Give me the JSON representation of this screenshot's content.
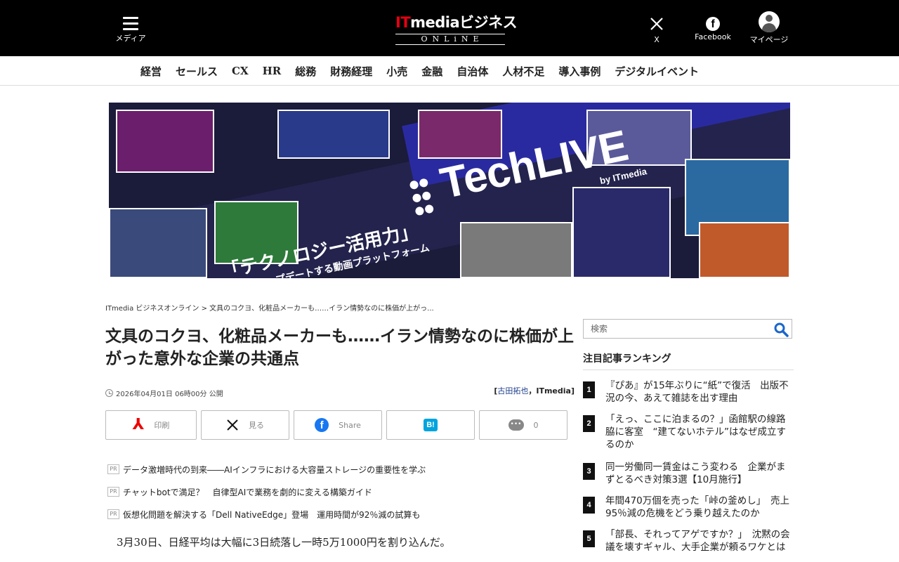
{
  "header": {
    "menu_label": "メディア",
    "logo_main_it": "IT",
    "logo_main_rest": "mediaビジネス",
    "logo_sub": "ONLiNE",
    "x_label": "X",
    "facebook_label": "Facebook",
    "mypage_label": "マイページ"
  },
  "categories": [
    "経営",
    "セールス",
    "CX",
    "HR",
    "総務",
    "財務経理",
    "小売",
    "金融",
    "自治体",
    "人材不足",
    "導入事例",
    "デジタルイベント"
  ],
  "banner": {
    "brand": "TechLIVE",
    "by": "by ITmedia",
    "tagline_1": "「テクノロジー活用力」",
    "tagline_2": "をアップデートする動画プラットフォーム"
  },
  "breadcrumb": {
    "home": "ITmedia ビジネスオンライン",
    "separator": " > ",
    "current": "文具のコクヨ、化粧品メーカーも……イラン情勢なのに株価が上がっ..."
  },
  "article": {
    "title": "文具のコクヨ、化粧品メーカーも……イラン情勢なのに株価が上がった意外な企業の共通点",
    "published": "2026年04月01日 06時00分 公開",
    "author_open": "[",
    "author_name": "古田拓也",
    "author_sep": "，",
    "author_org": "ITmedia",
    "author_close": "]",
    "lead": "3月30日、日経平均は大幅に3日続落し一時5万1000円を割り込んだ。"
  },
  "share": {
    "print_label": "印刷",
    "x_label": "見る",
    "facebook_label": "Share",
    "hatena_label": "B!",
    "comment_count": "0"
  },
  "pr": {
    "badge": "PR",
    "items": [
      "データ激増時代の到来――AIインフラにおける大容量ストレージの重要性を学ぶ",
      "チャットbotで満足？　自律型AIで業務を劇的に変える構築ガイド",
      "仮想化問題を解決する「Dell NativeEdge」登場　運用時間が92％減の試算も"
    ]
  },
  "sidebar": {
    "search_placeholder": "検索",
    "ranking_title": "注目記事ランキング",
    "ranking": [
      {
        "num": "1",
        "text": "『ぴあ』が15年ぶりに“紙”で復活　出版不況の今、あえて雑誌を出す理由"
      },
      {
        "num": "2",
        "text": "「えっ、ここに泊まるの？」函館駅の線路脇に客室　“建てないホテル”はなぜ成立するのか"
      },
      {
        "num": "3",
        "text": "同一労働同一賃金はこう変わる　企業がまずとるべき対策3選【10月施行】"
      },
      {
        "num": "4",
        "text": "年間470万個を売った「峠の釜めし」　売上95％減の危機をどう乗り越えたのか"
      },
      {
        "num": "5",
        "text": "「部長、それってアゲですか？」　沈黙の会議を壊すギャル、大手企業が頼るワケとは"
      }
    ]
  },
  "colors": {
    "header_bg": "#000000",
    "accent_red": "#e60012",
    "link_blue": "#1a3a8a",
    "facebook_blue": "#1877f2",
    "hatena_blue": "#00a4de",
    "search_icon": "#1a66cc"
  }
}
